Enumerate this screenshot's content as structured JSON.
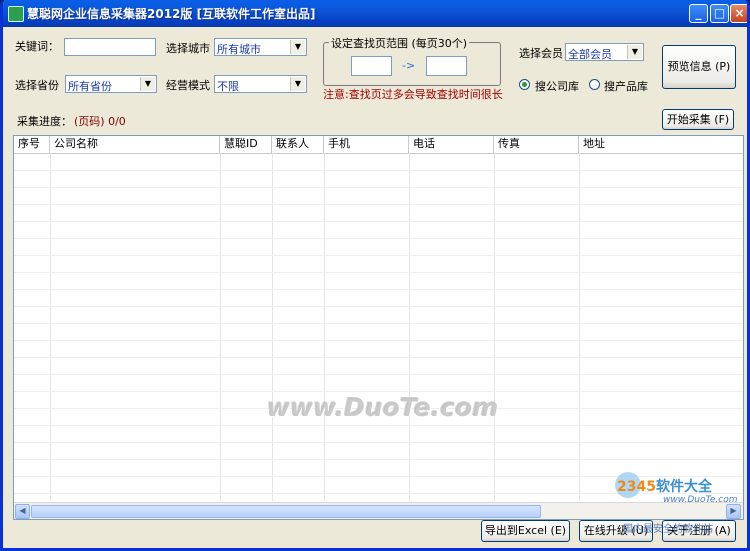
{
  "window": {
    "title": "慧聪网企业信息采集器2012版 [互联软件工作室出品]",
    "controls": {
      "minimize": "_",
      "maximize": "□",
      "close": "×"
    }
  },
  "form": {
    "keyword_label": "关键词：",
    "keyword_value": "",
    "city_label": "选择城市",
    "city_value": "所有城市",
    "province_label": "选择省份",
    "province_value": "所有省份",
    "mode_label": "经营模式",
    "mode_value": "不限",
    "page_range_title": "设定查找页范围 (每页30个)",
    "page_from": "",
    "page_arrow": "->",
    "page_to": "",
    "notice": "注意:查找页过多会导致查找时间很长",
    "member_label": "选择会员",
    "member_value": "全部会员",
    "radio_company": "搜公司库",
    "radio_product": "搜产品库",
    "radio_selected": "company",
    "preview_button": "预览信息 (P)",
    "progress_label": "采集进度：",
    "progress_value": "(页码) 0/0",
    "start_button": "开始采集 (F)"
  },
  "table": {
    "columns": [
      "序号",
      "公司名称",
      "慧聪ID",
      "联系人",
      "手机",
      "电话",
      "传真",
      "地址"
    ],
    "rows": []
  },
  "watermark": "www.DuoTe.com",
  "footer": {
    "export_button": "导出到Excel (E)",
    "upgrade_button": "在线升级 (U)",
    "register_button": "关于注册 (A)"
  },
  "overlay_logo": {
    "brand": "2345软件大全",
    "brand_number": "2345",
    "brand_text": "软件大全",
    "sub": "www.DuoTe.com",
    "caption": "国内最安全的软件站"
  },
  "colors": {
    "titlebar": "#0b55d6",
    "face": "#ece9d8",
    "notice": "#a00000",
    "progress": "#800000",
    "select_text": "#1c3aa9"
  }
}
